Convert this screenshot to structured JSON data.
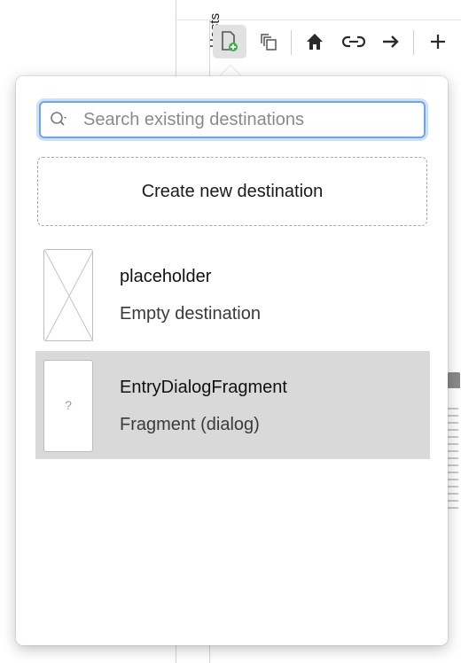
{
  "background": {
    "hosts_tab_label": "Hosts"
  },
  "toolbar": {
    "buttons": [
      {
        "icon": "new-destination-icon",
        "active": true
      },
      {
        "icon": "clone-icon",
        "active": false
      },
      {
        "icon": "home-icon",
        "active": false
      },
      {
        "icon": "link-icon",
        "active": false
      },
      {
        "icon": "arrow-right-icon",
        "active": false
      },
      {
        "icon": "plus-icon",
        "active": false
      }
    ]
  },
  "popover": {
    "search": {
      "placeholder": "Search existing destinations",
      "value": ""
    },
    "create_new_label": "Create new destination",
    "destinations": [
      {
        "name": "placeholder",
        "type": "Empty destination",
        "thumbnail": "empty-x",
        "selected": false
      },
      {
        "name": "EntryDialogFragment",
        "type": "Fragment (dialog)",
        "thumbnail": "unknown",
        "thumb_glyph": "?",
        "selected": true
      }
    ]
  },
  "colors": {
    "focus_ring": "#6ea6ea",
    "selected_row": "#d9d9d9",
    "add_icon_green": "#3fae49"
  }
}
